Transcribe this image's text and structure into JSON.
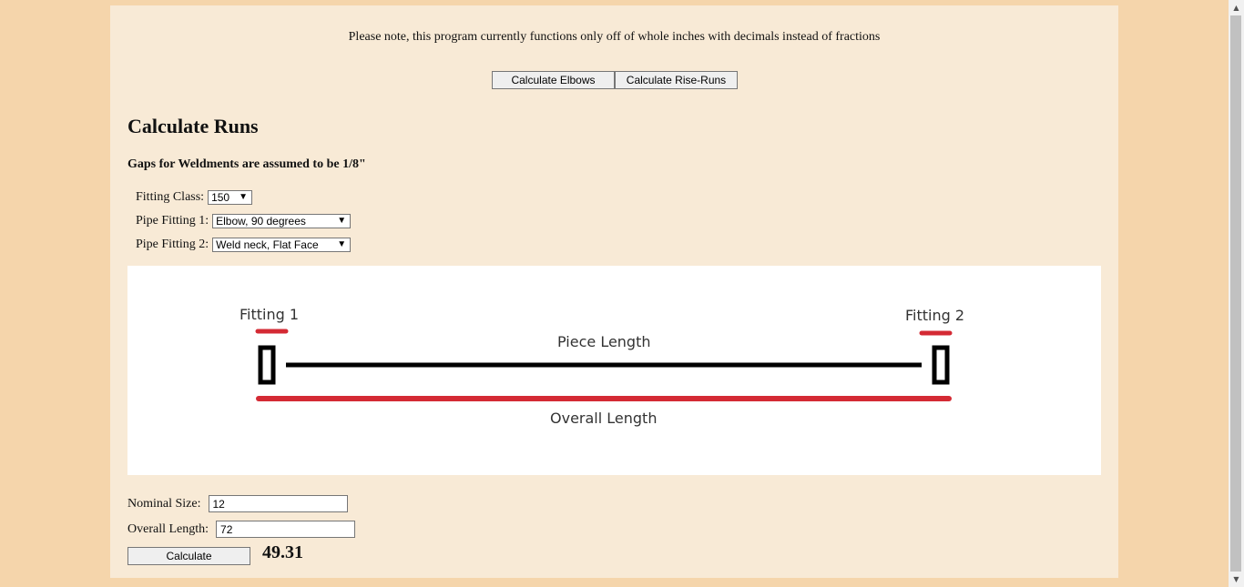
{
  "notice": "Please note, this program currently functions only off of whole inches with decimals instead of fractions",
  "nav": {
    "elbows_label": "Calculate Elbows",
    "rise_runs_label": "Calculate Rise-Runs"
  },
  "section": {
    "title": "Calculate Runs",
    "gap_note": "Gaps for Weldments are assumed to be 1/8\""
  },
  "form": {
    "fitting_class_label": "Fitting Class:",
    "fitting_class_value": "150",
    "pipe_fitting_1_label": "Pipe Fitting 1:",
    "pipe_fitting_1_value": "Elbow, 90 degrees",
    "pipe_fitting_2_label": "Pipe Fitting 2:",
    "pipe_fitting_2_value": "Weld neck, Flat Face",
    "nominal_size_label": "Nominal Size:",
    "nominal_size_value": "12",
    "overall_length_label": "Overall Length:",
    "overall_length_value": "72",
    "calculate_label": "Calculate",
    "result": "49.31"
  },
  "diagram": {
    "fitting1": "Fitting 1",
    "fitting2": "Fitting 2",
    "piece_length": "Piece Length",
    "overall_length": "Overall Length",
    "accent_color": "#d42a34",
    "line_color": "#000000"
  },
  "icons": {
    "dropdown": "chevron-down-icon",
    "scroll_up": "scroll-up-arrow-icon",
    "scroll_down": "scroll-down-arrow-icon"
  }
}
